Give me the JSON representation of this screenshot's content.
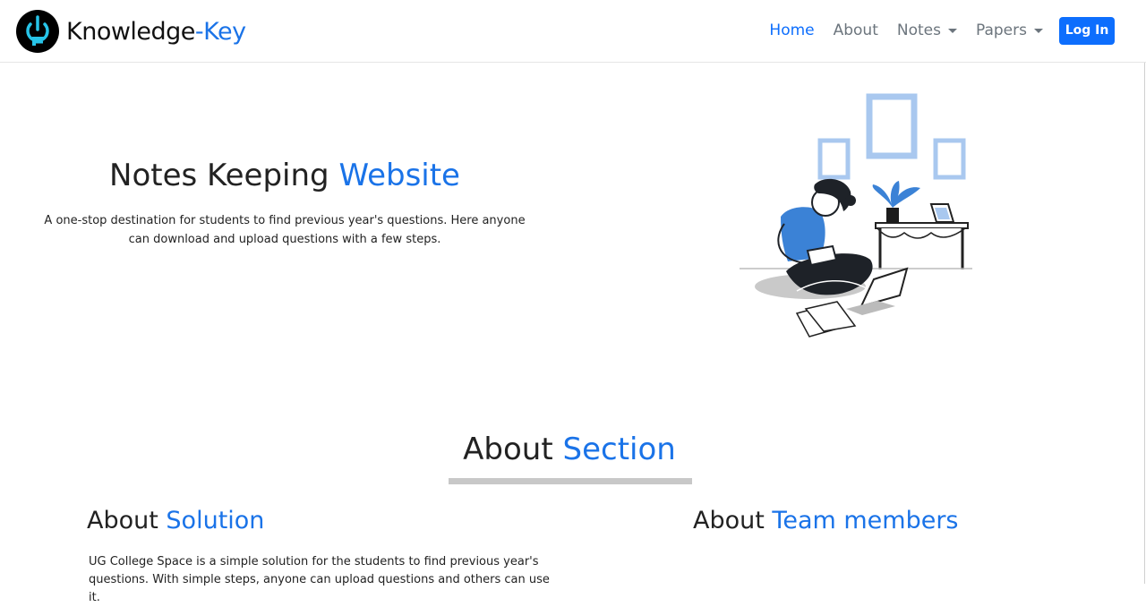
{
  "nav": {
    "brand_main": "Knowledge",
    "brand_accent": "-Key",
    "links": {
      "home": "Home",
      "about": "About",
      "notes": "Notes",
      "papers": "Papers"
    },
    "login_label": "Log In"
  },
  "hero": {
    "title_main": "Notes Keeping",
    "title_accent": "Website",
    "description": "A one-stop destination for students to find previous year's questions. Here anyone can download and upload questions with a few steps."
  },
  "about": {
    "title_main": "About",
    "title_accent": "Section",
    "solution": {
      "title_main": "About",
      "title_accent": "Solution",
      "text": "UG College Space is a simple solution for the students to find previous year's questions. With simple steps, anyone can upload questions and others can use it."
    },
    "team": {
      "title_main": "About",
      "title_accent": "Team members"
    }
  },
  "colors": {
    "accent": "#1a73e8",
    "primary_button": "#0d6efd",
    "nav_text": "#6c757d",
    "illustration_blue": "#3b82d6",
    "frame_blue": "#a9c8ef"
  },
  "icons": {
    "logo": "power-key-logo-icon",
    "dropdown": "caret-down-icon"
  }
}
